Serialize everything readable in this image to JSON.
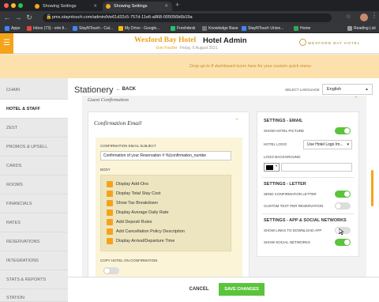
{
  "browser": {
    "tabs": [
      {
        "label": "Showing Settings",
        "active": false
      },
      {
        "label": "Showing Settings",
        "active": true
      }
    ],
    "url": "pms.stayntouch.com/admin/h/e61d32c5-757d-11e6-a868-005056b6b19a",
    "bookmarks": [
      "Apps",
      "Inbox (73) - erin.fi...",
      "StayNTouch - Cal...",
      "My Drive - Google...",
      "Freshdesk",
      "Knowledge Base",
      "StayNTouch Unive...",
      "Home",
      "Reading List"
    ]
  },
  "header": {
    "hotel": "Wexford Bay Hotel",
    "admin": "Hotel Admin",
    "user": "Erin Fischer",
    "date": "Friday, 6 August 2021",
    "logo_text": "WEXFORD BAY HOTEL",
    "drop_hint": "Drop up to 8 dashboard icons here for your custom quick menu"
  },
  "sidebar": {
    "items": [
      {
        "label": "CHAIN"
      },
      {
        "label": "HOTEL & STAFF",
        "active": true
      },
      {
        "label": "ZEST"
      },
      {
        "label": "PROMOS & UPSELL"
      },
      {
        "label": "CARDS"
      },
      {
        "label": "ROOMS"
      },
      {
        "label": "FINANCIALS"
      },
      {
        "label": "RATES"
      },
      {
        "label": "RESERVATIONS"
      },
      {
        "label": "INTEGRATIONS"
      },
      {
        "label": "STATS & REPORTS"
      },
      {
        "label": "STATION"
      }
    ]
  },
  "page": {
    "title": "Stationery",
    "back": "BACK",
    "select_language_label": "SELECT LANGUAGE",
    "language": "English",
    "section": "Guest Confirmation"
  },
  "email": {
    "title": "Confirmation Email",
    "subject_label": "CONFIRMATION EMAIL SUBJECT",
    "subject_value": "Confirmation of your  Reservation # %{confirmation_numbe",
    "body_label": "BODY",
    "tags": [
      "Display Add-Ons",
      "Display Total Stay Cost",
      "Show Tax Breakdown",
      "Display Average Daily Rate",
      "Add Deposit Rules",
      "Add Cancellation Policy Description",
      "Display Arrival/Departure Time"
    ],
    "copy_label": "COPY HOTEL ON CONFIRMATION"
  },
  "settings": {
    "email_head": "SETTINGS - EMAIL",
    "show_hotel_picture": "SHOW HOTEL PICTURE",
    "hotel_logo": "HOTEL LOGO",
    "hotel_logo_value": "Use Hotel Logo Im...",
    "logo_background": "LOGO BACKGROUND",
    "letter_head": "SETTINGS - LETTER",
    "send_confirmation_letter": "SEND CONFIRMATION LETTER",
    "custom_text": "CUSTOM TEXT PER RESERVATION",
    "app_head": "SETTINGS - APP & SOCIAL NETWORKS",
    "download_app": "SHOW LINKS TO DOWNLOAD APP",
    "social_networks": "SHOW SOCIAL NETWORKS",
    "toggles": {
      "show_hotel_picture": true,
      "send_confirmation_letter": true,
      "custom_text": false,
      "download_app": false,
      "social_networks": true,
      "copy_hotel": false
    }
  },
  "footer": {
    "cancel": "CANCEL",
    "save": "SAVE CHANGES"
  },
  "colors": {
    "accent": "#f5a31a",
    "green": "#5ac43a",
    "brand_gold": "#e8a21a"
  }
}
